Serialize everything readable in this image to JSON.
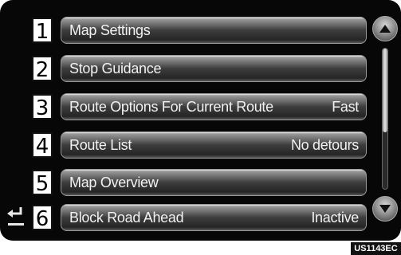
{
  "menu": {
    "items": [
      {
        "number": "1",
        "label": "Map Settings",
        "value": ""
      },
      {
        "number": "2",
        "label": "Stop Guidance",
        "value": ""
      },
      {
        "number": "3",
        "label": "Route Options For Current Route",
        "value": "Fast"
      },
      {
        "number": "4",
        "label": "Route List",
        "value": "No detours"
      },
      {
        "number": "5",
        "label": "Map Overview",
        "value": ""
      },
      {
        "number": "6",
        "label": "Block Road Ahead",
        "value": "Inactive"
      }
    ]
  },
  "scrollbar": {
    "position_fraction": 0.0,
    "visible_fraction": 0.6
  },
  "icons": {
    "back": "back-arrow-icon",
    "scroll_up": "triangle-up-icon",
    "scroll_down": "triangle-down-icon"
  },
  "caption": {
    "code": "US1143EC"
  },
  "colors": {
    "screen_bg": "#070707",
    "button_text": "#f2f2f2",
    "number_bg": "#ffffff"
  }
}
